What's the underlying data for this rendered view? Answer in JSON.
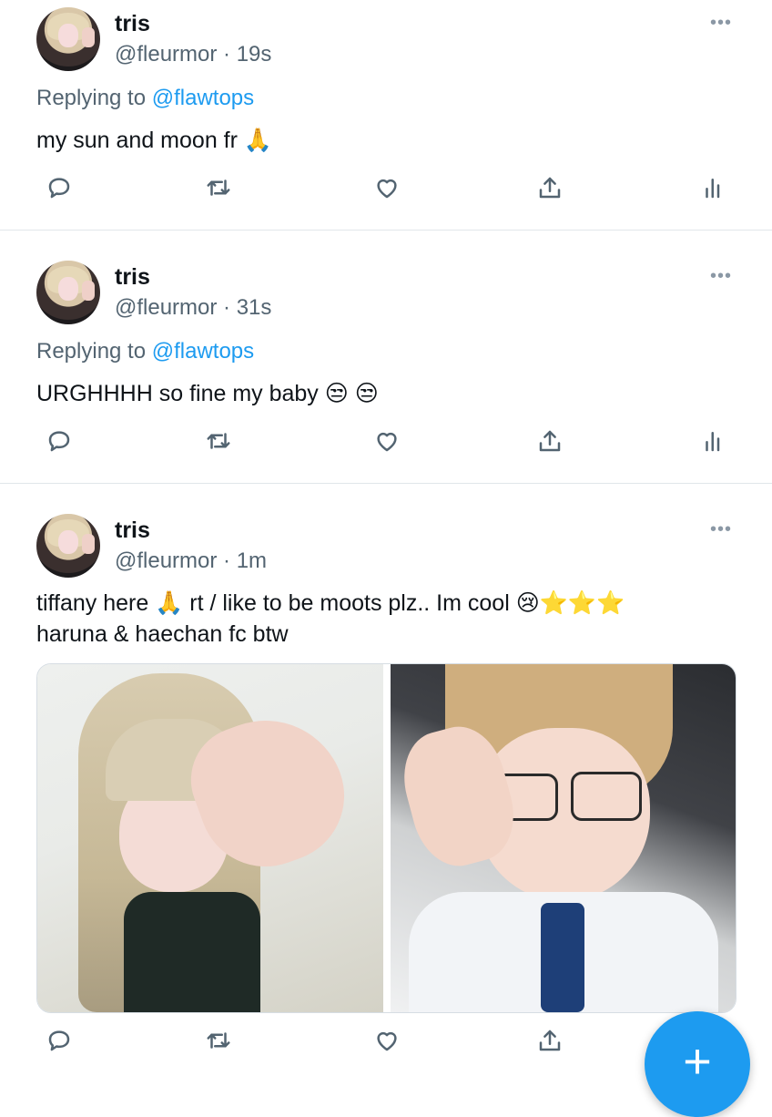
{
  "tweets": [
    {
      "name": "tris",
      "handle_line": "@fleurmor · 19s",
      "replying_prefix": "Replying to",
      "replying_mention": "@flawtops",
      "text": "my sun and moon fr 🙏"
    },
    {
      "name": "tris",
      "handle_line": "@fleurmor · 31s",
      "replying_prefix": "Replying to",
      "replying_mention": "@flawtops",
      "text": "URGHHHH so fine my baby 😒 😒"
    },
    {
      "name": "tris",
      "handle_line": "@fleurmor · 1m",
      "text_line1": "tiffany here 🙏 rt / like to be moots plz.. Im cool 😢⭐⭐⭐",
      "text_line2": "haruna & haechan fc btw"
    }
  ],
  "more_label": "•••",
  "fab_label": "+",
  "icons": {
    "reply": "reply-icon",
    "retweet": "retweet-icon",
    "like": "like-icon",
    "share": "share-icon",
    "analytics": "analytics-icon"
  },
  "colors": {
    "accent": "#1d9bf0",
    "secondary_text": "#536471",
    "primary_text": "#0f1419",
    "separator": "#e1e6ea"
  }
}
